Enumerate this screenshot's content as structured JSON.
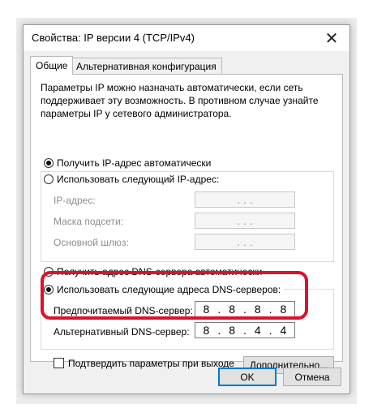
{
  "window": {
    "title": "Свойства: IP версии 4 (TCP/IPv4)",
    "close_glyph": "✕"
  },
  "tabs": [
    {
      "label": "Общие",
      "active": true
    },
    {
      "label": "Альтернативная конфигурация",
      "active": false
    }
  ],
  "description": "Параметры IP можно назначать автоматически, если сеть поддерживает эту возможность. В противном случае узнайте параметры IP у сетевого администратора.",
  "ip_section": {
    "auto_label": "Получить IP-адрес автоматически",
    "manual_label": "Использовать следующий IP-адрес:",
    "fields": [
      {
        "label": "IP-адрес:",
        "value": ". . ."
      },
      {
        "label": "Маска подсети:",
        "value": ". . ."
      },
      {
        "label": "Основной шлюз:",
        "value": ". . ."
      }
    ]
  },
  "dns_section": {
    "auto_label": "Получить адрес DNS-сервера автоматически",
    "manual_label": "Использовать следующие адреса DNS-серверов:",
    "preferred_label": "Предпочитаемый DNS-сервер:",
    "preferred_value": [
      "8",
      "8",
      "8",
      "8"
    ],
    "alternate_label": "Альтернативный DNS-сервер:",
    "alternate_value": [
      "8",
      "8",
      "4",
      "4"
    ]
  },
  "validate_label": "Подтвердить параметры при выходе",
  "advanced_button": "Дополнительно...",
  "ok_button": "OK",
  "cancel_button": "Отмена",
  "colors": {
    "highlight": "#e0102a",
    "default_button_border": "#0078d7"
  },
  "icons": {
    "close": "close-icon",
    "radio_checked": "radio-checked-icon",
    "radio_unchecked": "radio-unchecked-icon",
    "checkbox": "checkbox-unchecked-icon"
  }
}
